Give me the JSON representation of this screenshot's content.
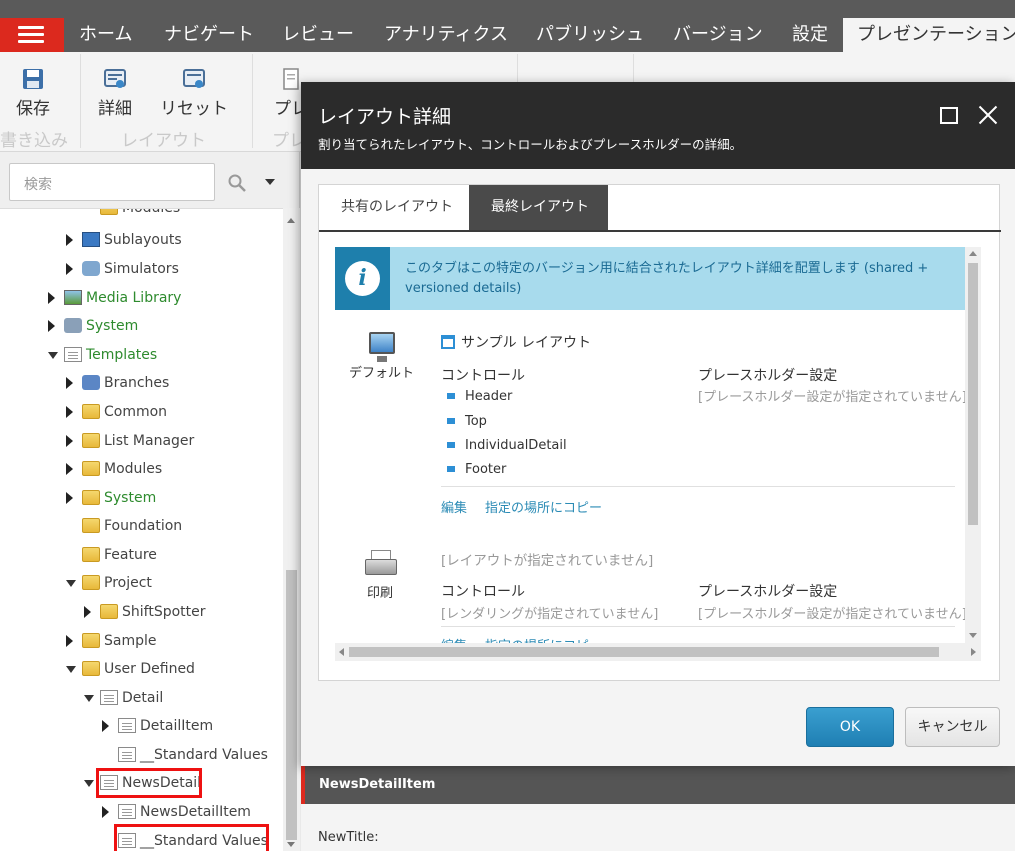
{
  "topnav": {
    "tabs": [
      "ホーム",
      "ナビゲート",
      "レビュー",
      "アナリティクス",
      "パブリッシュ",
      "バージョン",
      "設定",
      "プレゼンテーション"
    ],
    "active_tab": "プレゼンテーション"
  },
  "ribbon": {
    "save_label": "保存",
    "details_label": "詳細",
    "reset_label": "リセット",
    "preview_label": "プレ",
    "group_write": "書き込み",
    "group_layout": "レイアウト",
    "group_preview": "プレ"
  },
  "search": {
    "placeholder": "検索"
  },
  "tree": [
    {
      "label": "Modules",
      "icon": "folder-icon"
    },
    {
      "label": "Sublayouts",
      "icon": "sublayouts-icon"
    },
    {
      "label": "Simulators",
      "icon": "simulators-icon"
    },
    {
      "label": "Media Library",
      "icon": "media-library-icon"
    },
    {
      "label": "System",
      "icon": "system-icon"
    },
    {
      "label": "Templates",
      "icon": "templates-icon"
    },
    {
      "label": "Branches",
      "icon": "branches-icon"
    },
    {
      "label": "Common",
      "icon": "folder-icon"
    },
    {
      "label": "List Manager",
      "icon": "folder-icon"
    },
    {
      "label": "Modules",
      "icon": "folder-icon"
    },
    {
      "label": "System",
      "icon": "folder-icon"
    },
    {
      "label": "Foundation",
      "icon": "folder-icon"
    },
    {
      "label": "Feature",
      "icon": "folder-icon"
    },
    {
      "label": "Project",
      "icon": "folder-icon"
    },
    {
      "label": "ShiftSpotter",
      "icon": "folder-icon"
    },
    {
      "label": "Sample",
      "icon": "folder-icon"
    },
    {
      "label": "User Defined",
      "icon": "folder-icon"
    },
    {
      "label": "Detail",
      "icon": "template-icon"
    },
    {
      "label": "DetailItem",
      "icon": "document-icon"
    },
    {
      "label": "__Standard Values",
      "icon": "document-icon"
    },
    {
      "label": "NewsDetail",
      "icon": "template-icon"
    },
    {
      "label": "NewsDetailItem",
      "icon": "document-icon"
    },
    {
      "label": "__Standard Values",
      "icon": "document-icon"
    }
  ],
  "content": {
    "section_header": "NewsDetailItem",
    "field_label": "NewTitle:"
  },
  "dialog": {
    "title": "レイアウト詳細",
    "subtitle": "割り当てられたレイアウト、コントロールおよびプレースホルダーの詳細。",
    "tabs": [
      "共有のレイアウト",
      "最終レイアウト"
    ],
    "active_tab": "最終レイアウト",
    "info_text": "このタブはこの特定のバージョン用に結合されたレイアウト詳細を配置します (shared + versioned details)",
    "devices": [
      {
        "name": "デフォルト",
        "layout": "サンプル レイアウト",
        "controls_label": "コントロール",
        "controls": [
          "Header",
          "Top",
          "IndividualDetail",
          "Footer"
        ],
        "placeholder_label": "プレースホルダー設定",
        "placeholder_value": "[プレースホルダー設定が指定されていません]",
        "edit_link": "編集",
        "copy_link": "指定の場所にコピー"
      },
      {
        "name": "印刷",
        "layout": "[レイアウトが指定されていません]",
        "controls_label": "コントロール",
        "controls_empty": "[レンダリングが指定されていません]",
        "placeholder_label": "プレースホルダー設定",
        "placeholder_value": "[プレースホルダー設定が指定されていません]",
        "edit_link": "編集",
        "copy_link": "指定の場所にコピー"
      }
    ],
    "ok_label": "OK",
    "cancel_label": "キャンセル"
  },
  "colors": {
    "brand_red": "#dc291e",
    "dialog_header": "#2b2b2b",
    "info_bar": "#a8dbed",
    "link": "#2b8bb5",
    "ok_button": "#2a8fc4"
  }
}
